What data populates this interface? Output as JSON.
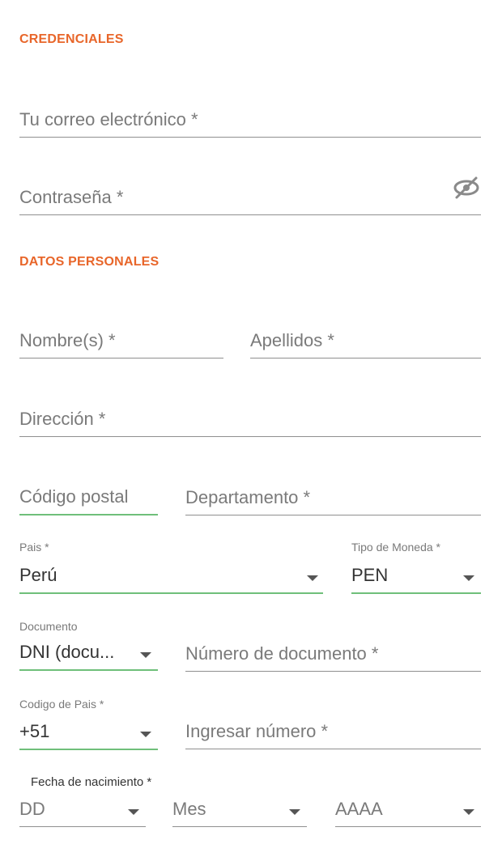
{
  "credentials": {
    "title": "CREDENCIALES",
    "email_placeholder": "Tu correo electrónico *",
    "password_placeholder": "Contraseña *",
    "password_toggle_icon": "eye-slash-icon"
  },
  "personal": {
    "title": "DATOS PERSONALES",
    "first_name": "Nombre(s) *",
    "last_name": "Apellidos *",
    "address": "Dirección *",
    "postal_code": "Código postal",
    "department": "Departamento *",
    "country_label": "Pais *",
    "country_value": "Perú",
    "currency_label": "Tipo de Moneda *",
    "currency_value": "PEN",
    "document_label": "Documento",
    "document_value": "DNI (docu...",
    "document_number": "Número de documento *",
    "country_code_label": "Codigo de Pais *",
    "country_code_value": "+51",
    "phone_placeholder": "Ingresar número *",
    "birth_label": "Fecha de nacimiento *",
    "birth_day": "DD",
    "birth_month": "Mes",
    "birth_year": "AAAA"
  },
  "colors": {
    "accent": "#e8662a",
    "focus_underline": "#6fbf7a",
    "underline": "#8f8f8f"
  }
}
